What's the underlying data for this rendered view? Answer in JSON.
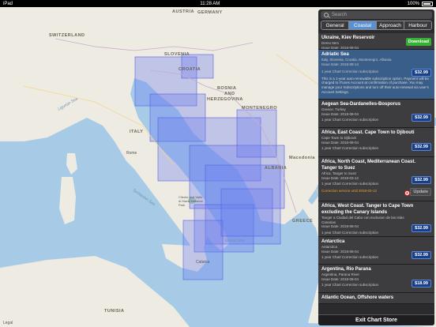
{
  "status_bar": {
    "carrier": "iPad",
    "time": "11:28 AM",
    "battery": "100%"
  },
  "map": {
    "country_labels": {
      "germany": "GERMANY",
      "austria": "AUSTRIA",
      "switzerland": "SWITZERLAND",
      "slovenia": "SLOVENIA",
      "croatia": "CROATIA",
      "bosnia": "BOSNIA",
      "and": "AND",
      "herzegovina": "HERZEGOVINA",
      "montenegro": "MONTENEGRO",
      "italy": "ITALY",
      "albania": "ALBANIA",
      "macedonia": "Macedonia",
      "greece": "GREECE",
      "tunisia": "TUNISIA"
    },
    "city_labels": {
      "rome": "Rome",
      "park": "Cilento and Vallo di Diano National Park",
      "catania": "Catania"
    },
    "sea_labels": {
      "ligurian": "Ligurian Sea",
      "tyrrhenian": "Tyrrhenian Sea",
      "ionian": "Ionian Sea"
    },
    "legal": "Legal"
  },
  "panel": {
    "search_placeholder": "Search",
    "tabs": [
      "General",
      "Coastal",
      "Approach",
      "Harbour"
    ],
    "active_tab": "Coastal",
    "items": [
      {
        "title": "Ukraine, Kiev Reservoir",
        "sub": "Demo Item",
        "issue": "Issue Date: 2018-08-04",
        "button": "Download",
        "button_type": "download"
      },
      {
        "title": "Adriatic Sea",
        "sub": "Italy, Slovenia, Croatia, Montenegro, Albania",
        "issue": "Issue Date: 2018-08-14",
        "subscription": "1 year Chart Correction subscription",
        "description": "This is a 1-year auto-renewable subscription option. Payment will be charged to iTunes Account at confirmation of purchase. You may manage your Subscriptions and turn off their auto-renewal via user's Account Settings.",
        "button": "$32.99",
        "button_type": "price",
        "selected": true
      },
      {
        "title": "Aegean Sea-Dardanelles-Bosporus",
        "sub": "Greece, Turkey",
        "issue": "Issue Date: 2018-08-04",
        "subscription": "1 year Chart Correction subscription",
        "button": "$32.99",
        "button_type": "price"
      },
      {
        "title": "Africa, East Coast. Cape Town to Djibouti",
        "sub": "Cape Town to Djibouti",
        "issue": "Issue Date: 2018-08-04",
        "subscription": "1 year Chart Correction subscription",
        "button": "$32.99",
        "button_type": "price"
      },
      {
        "title": "Africa, North Coast, Mediterranean Coast. Tanger to Suez",
        "sub": "Africa, Tanger to Suez",
        "issue": "Issue Date: 2018-03-12",
        "subscription": "1 year Chart Correction subscription",
        "warning": "Correction service until 2019-03-12",
        "button": "$32.99",
        "button_type": "price",
        "update": "Update"
      },
      {
        "title": "Africa, West Coast. Tanger to Cape Town excluding the Canary Islands",
        "sub": "Tanger a Ciudad del Cabo con exclusion de las Islas Canarias",
        "issue": "Issue Date: 2018-08-04",
        "subscription": "1 year Chart Correction subscription",
        "button": "$32.99",
        "button_type": "price"
      },
      {
        "title": "Antarctica",
        "sub": "Antarctica",
        "issue": "Issue Date: 2018-08-04",
        "subscription": "1 year Chart Correction subscription",
        "button": "$32.99",
        "button_type": "price"
      },
      {
        "title": "Argentina, Rio Parana",
        "sub": "Argentina, Parana River",
        "issue": "Issue Date: 2018-08-04",
        "subscription": "1 year Chart Correction subscription",
        "button": "$18.99",
        "button_type": "price"
      },
      {
        "title": "Atlantic Ocean, Offshore waters",
        "sub": "",
        "issue": ""
      }
    ],
    "exit_label": "Exit Chart Store"
  },
  "colors": {
    "accent": "#5a8fd1",
    "selected_row": "#3a5e8a",
    "download": "#35b233",
    "price": "#1b3f86",
    "warning": "#f0a030",
    "coverage": "#6b7bf0"
  }
}
